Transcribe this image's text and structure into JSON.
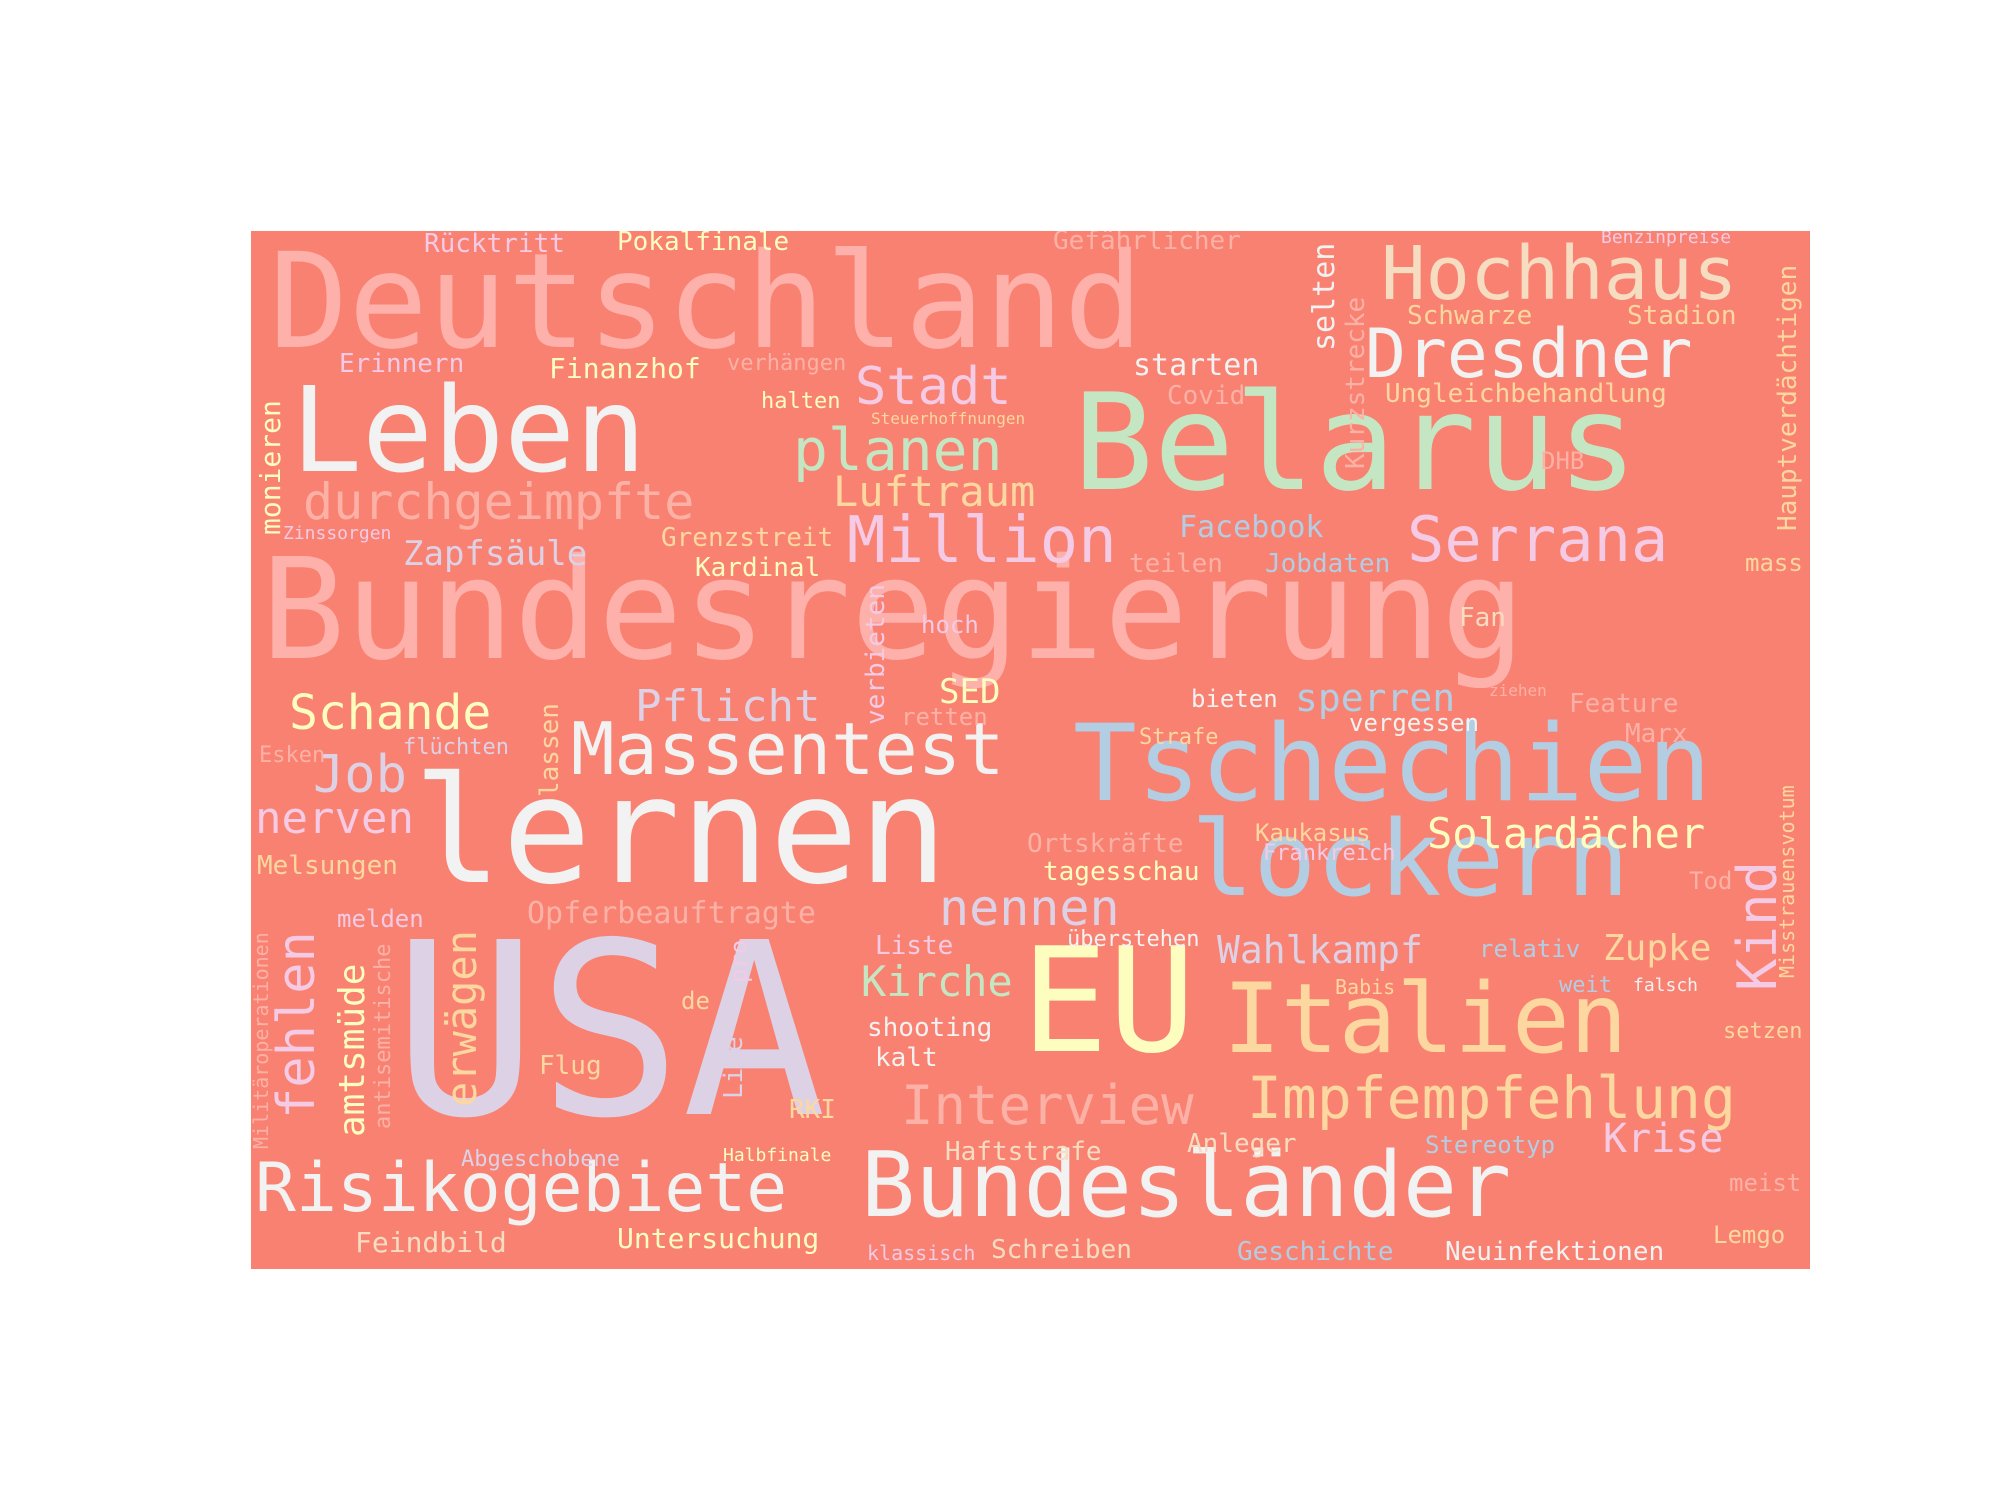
{
  "background_color": "#f98171",
  "words": [
    {
      "text": "Deutschland",
      "color": "#feb0aa"
    },
    {
      "text": "Bundesregierung",
      "color": "#feb0aa"
    },
    {
      "text": "Belarus",
      "color": "#c5e6c3"
    },
    {
      "text": "Leben",
      "color": "#f2f2f2"
    },
    {
      "text": "lernen",
      "color": "#f2f2f2"
    },
    {
      "text": "USA",
      "color": "#ddd1e6"
    },
    {
      "text": "Tschechien",
      "color": "#b3cde3"
    },
    {
      "text": "lockern",
      "color": "#b3cde3"
    },
    {
      "text": "EU",
      "color": "#fcfdbf"
    },
    {
      "text": "Italien",
      "color": "#fcd79f"
    },
    {
      "text": "Bundesländer",
      "color": "#f2f2f2"
    },
    {
      "text": "Hochhaus",
      "color": "#f6dcc0"
    },
    {
      "text": "Dresdner",
      "color": "#f2f2f2"
    },
    {
      "text": "Massentest",
      "color": "#f2f2f2"
    },
    {
      "text": "Million",
      "color": "#f4cae4"
    },
    {
      "text": "Serrana",
      "color": "#f4cae4"
    },
    {
      "text": "Stadt",
      "color": "#f4cae4"
    },
    {
      "text": "planen",
      "color": "#c5e6c3"
    },
    {
      "text": "durchgeimpfte",
      "color": "#fcb1a6"
    },
    {
      "text": "Luftraum",
      "color": "#fcd79f"
    },
    {
      "text": "Risikogebiete",
      "color": "#f2f2f2"
    },
    {
      "text": "Impfempfehlung",
      "color": "#fcd79f"
    },
    {
      "text": "Interview",
      "color": "#fcb1a6"
    },
    {
      "text": "Schande",
      "color": "#fcfdbf"
    },
    {
      "text": "Job",
      "color": "#ddd1e6"
    },
    {
      "text": "nerven",
      "color": "#f4cae4"
    },
    {
      "text": "nennen",
      "color": "#ddd1e6"
    },
    {
      "text": "Solardächer",
      "color": "#fcfdbf"
    },
    {
      "text": "Wahlkampf",
      "color": "#ddd1e6"
    },
    {
      "text": "Kirche",
      "color": "#c5e6c3"
    },
    {
      "text": "Krise",
      "color": "#f4cae4"
    },
    {
      "text": "Pflicht",
      "color": "#ddd1e6"
    },
    {
      "text": "Zapfsäule",
      "color": "#ddd1e6"
    },
    {
      "text": "Facebook",
      "color": "#b3cde3"
    },
    {
      "text": "sperren",
      "color": "#b3cde3"
    },
    {
      "text": "Opferbeauftragte",
      "color": "#fcb1a6"
    },
    {
      "text": "Zupke",
      "color": "#fcd79f"
    },
    {
      "text": "Rücktritt",
      "color": "#f4cae4"
    },
    {
      "text": "Pokalfinale",
      "color": "#fcfdbf"
    },
    {
      "text": "Gefährlicher",
      "color": "#fcb1a6"
    },
    {
      "text": "Benzinpreise",
      "color": "#f4cae4"
    },
    {
      "text": "Schwarze",
      "color": "#fcd79f"
    },
    {
      "text": "Stadion",
      "color": "#fcd79f"
    },
    {
      "text": "Erinnern",
      "color": "#f4cae4"
    },
    {
      "text": "Finanzhof",
      "color": "#fcfdbf"
    },
    {
      "text": "verhängen",
      "color": "#fcb1a6"
    },
    {
      "text": "starten",
      "color": "#f2f2f2"
    },
    {
      "text": "Covid",
      "color": "#fcb1a6"
    },
    {
      "text": "Ungleichbehandlung",
      "color": "#fcd79f"
    },
    {
      "text": "halten",
      "color": "#fcfdbf"
    },
    {
      "text": "Steuerhoffnungen",
      "color": "#fcd79f"
    },
    {
      "text": "DHB",
      "color": "#fcb1a6"
    },
    {
      "text": "Zinssorgen",
      "color": "#f4cae4"
    },
    {
      "text": "Grenzstreit",
      "color": "#fcd79f"
    },
    {
      "text": "Kardinal",
      "color": "#fcfdbf"
    },
    {
      "text": "teilen",
      "color": "#fcb1a6"
    },
    {
      "text": "Jobdaten",
      "color": "#b3cde3"
    },
    {
      "text": "mass",
      "color": "#fcd79f"
    },
    {
      "text": "hoch",
      "color": "#f4cae4"
    },
    {
      "text": "Fan",
      "color": "#f6dcc0"
    },
    {
      "text": "SED",
      "color": "#fcfdbf"
    },
    {
      "text": "retten",
      "color": "#fcb1a6"
    },
    {
      "text": "bieten",
      "color": "#f2f2f2"
    },
    {
      "text": "ziehen",
      "color": "#fcb1a6"
    },
    {
      "text": "Feature",
      "color": "#fcb1a6"
    },
    {
      "text": "vergessen",
      "color": "#f2f2f2"
    },
    {
      "text": "Strafe",
      "color": "#fcd79f"
    },
    {
      "text": "Marx",
      "color": "#fcb1a6"
    },
    {
      "text": "Esken",
      "color": "#fcb1a6"
    },
    {
      "text": "flüchten",
      "color": "#ddd1e6"
    },
    {
      "text": "Melsungen",
      "color": "#fcd79f"
    },
    {
      "text": "Ortskräfte",
      "color": "#fcb1a6"
    },
    {
      "text": "Kaukasus",
      "color": "#fcd79f"
    },
    {
      "text": "Frankreich",
      "color": "#f4cae4"
    },
    {
      "text": "tagesschau",
      "color": "#fcfdbf"
    },
    {
      "text": "Tod",
      "color": "#fcb1a6"
    },
    {
      "text": "melden",
      "color": "#f4cae4"
    },
    {
      "text": "Liste",
      "color": "#f4cae4"
    },
    {
      "text": "überstehen",
      "color": "#f2f2f2"
    },
    {
      "text": "relativ",
      "color": "#b3cde3"
    },
    {
      "text": "Babis",
      "color": "#fcd79f"
    },
    {
      "text": "weit",
      "color": "#b3cde3"
    },
    {
      "text": "falsch",
      "color": "#f2f2f2"
    },
    {
      "text": "de",
      "color": "#fcd79f"
    },
    {
      "text": "shooting",
      "color": "#f2f2f2"
    },
    {
      "text": "kalt",
      "color": "#f2f2f2"
    },
    {
      "text": "setzen",
      "color": "#fcd79f"
    },
    {
      "text": "Flug",
      "color": "#fcd79f"
    },
    {
      "text": "RKI",
      "color": "#fcd79f"
    },
    {
      "text": "Haftstrafe",
      "color": "#f6dcc0"
    },
    {
      "text": "Anleger",
      "color": "#f6dcc0"
    },
    {
      "text": "Stereotyp",
      "color": "#b3cde3"
    },
    {
      "text": "Abgeschobene",
      "color": "#ddd1e6"
    },
    {
      "text": "Halbfinale",
      "color": "#fcfdbf"
    },
    {
      "text": "meist",
      "color": "#fcb1a6"
    },
    {
      "text": "Feindbild",
      "color": "#f6dcc0"
    },
    {
      "text": "Untersuchung",
      "color": "#fcfdbf"
    },
    {
      "text": "klassisch",
      "color": "#f4cae4"
    },
    {
      "text": "Schreiben",
      "color": "#f6dcc0"
    },
    {
      "text": "Geschichte",
      "color": "#b3cde3"
    },
    {
      "text": "Neuinfektionen",
      "color": "#f2f2f2"
    },
    {
      "text": "Lemgo",
      "color": "#fcd79f"
    },
    {
      "text": "selten",
      "color": "#f2f2f2"
    },
    {
      "text": "Kurzstrecke",
      "color": "#fcb1a6"
    },
    {
      "text": "Hauptverdächtigen",
      "color": "#fcd79f"
    },
    {
      "text": "monieren",
      "color": "#fcfdbf"
    },
    {
      "text": "verbieten",
      "color": "#f4cae4"
    },
    {
      "text": "lassen",
      "color": "#fcd79f"
    },
    {
      "text": "fehlen",
      "color": "#f4cae4"
    },
    {
      "text": "erwägen",
      "color": "#fcd79f"
    },
    {
      "text": "amtsmüde",
      "color": "#fcfdbf"
    },
    {
      "text": "antisemitische",
      "color": "#fcb1a6"
    },
    {
      "text": "Militäroperationen",
      "color": "#fcb1a6"
    },
    {
      "text": "pro",
      "color": "#f4cae4"
    },
    {
      "text": "Live",
      "color": "#ddd1e6"
    },
    {
      "text": "Kind",
      "color": "#f4cae4"
    },
    {
      "text": "Misstrauensvotum",
      "color": "#fcd79f"
    }
  ]
}
